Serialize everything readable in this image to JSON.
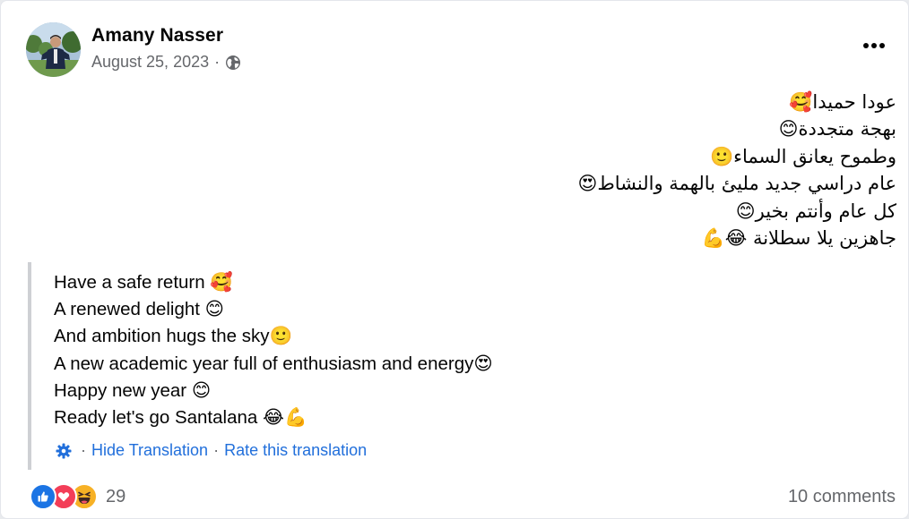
{
  "post": {
    "author": "Amany Nasser",
    "date": "August 25, 2023",
    "meta_separator": "·",
    "privacy_icon": "globe-icon",
    "menu_icon": "more-horizontal-icon"
  },
  "content": {
    "arabic_lines": [
      "عودا حميدا🥰",
      "بهجة متجددة😊",
      "وطموح يعانق السماء🙂",
      "عام دراسي جديد مليئ بالهمة والنشاط😍",
      "كل عام وأنتم بخير😊",
      "جاهزين يلا سطلانة 😂💪"
    ]
  },
  "translation": {
    "lines": [
      "Have a safe return 🥰",
      "A renewed delight 😊",
      "And ambition hugs the sky🙂",
      "A new academic year full of enthusiasm and energy😍",
      "Happy new year 😊",
      "Ready let's go Santalana 😂💪"
    ],
    "separator": "·",
    "hide_label": "Hide Translation",
    "rate_label": "Rate this translation",
    "settings_icon": "gear-icon"
  },
  "footer": {
    "reaction_icons": [
      "like-icon",
      "love-icon",
      "haha-icon"
    ],
    "reaction_count": "29",
    "comments": "10 comments"
  },
  "colors": {
    "link": "#216fdb",
    "secondary_text": "#65676b",
    "like": "#1b74e4",
    "love": "#f33e58",
    "haha": "#f7b125",
    "quote_border": "#ced0d4"
  }
}
